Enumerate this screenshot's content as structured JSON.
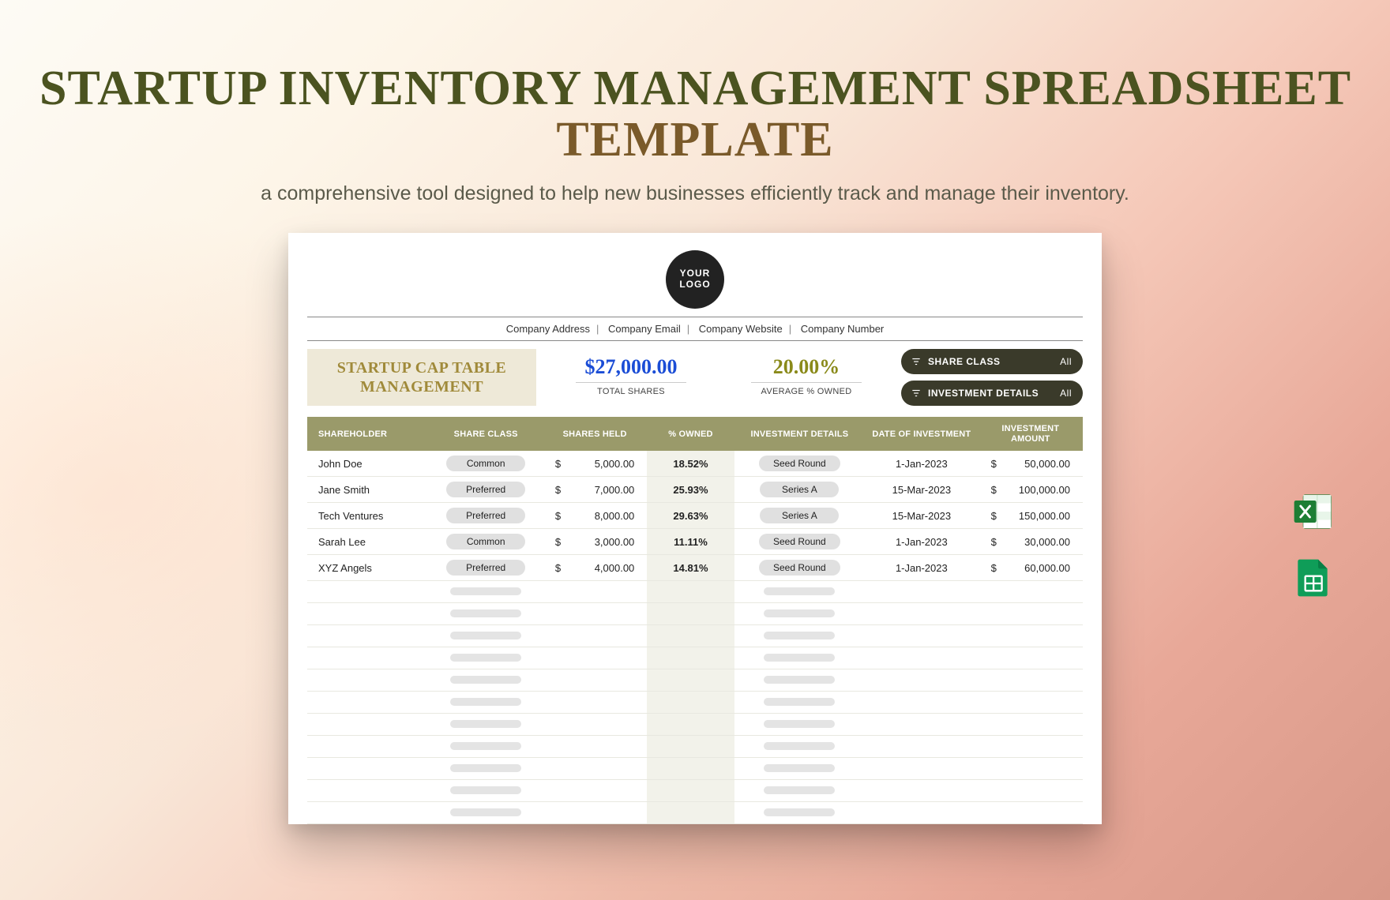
{
  "page": {
    "title_main": "STARTUP INVENTORY MANAGEMENT SPREADSHEET",
    "title_accent": "TEMPLATE",
    "subtitle": "a comprehensive tool designed to help new businesses efficiently track and manage their inventory."
  },
  "logo": {
    "line1": "YOUR",
    "line2": "LOGO"
  },
  "company_meta": {
    "address": "Company Address",
    "email": "Company Email",
    "website": "Company Website",
    "number": "Company Number"
  },
  "sheet": {
    "title": "STARTUP CAP TABLE MANAGEMENT",
    "total_shares": {
      "value": "$27,000.00",
      "label": "TOTAL SHARES"
    },
    "avg_owned": {
      "value": "20.00%",
      "label": "AVERAGE % OWNED"
    }
  },
  "filters": {
    "share_class": {
      "label": "SHARE CLASS",
      "value": "All"
    },
    "investment_details": {
      "label": "INVESTMENT DETAILS",
      "value": "All"
    }
  },
  "columns": {
    "shareholder": "SHAREHOLDER",
    "share_class": "SHARE CLASS",
    "shares_held": "SHARES HELD",
    "pct_owned": "% OWNED",
    "inv_details": "INVESTMENT DETAILS",
    "date": "DATE OF INVESTMENT",
    "amount": "INVESTMENT AMOUNT"
  },
  "rows": [
    {
      "shareholder": "John Doe",
      "share_class": "Common",
      "shares_held": "5,000.00",
      "pct_owned": "18.52%",
      "inv_details": "Seed Round",
      "date": "1-Jan-2023",
      "amount": "50,000.00"
    },
    {
      "shareholder": "Jane Smith",
      "share_class": "Preferred",
      "shares_held": "7,000.00",
      "pct_owned": "25.93%",
      "inv_details": "Series A",
      "date": "15-Mar-2023",
      "amount": "100,000.00"
    },
    {
      "shareholder": "Tech Ventures",
      "share_class": "Preferred",
      "shares_held": "8,000.00",
      "pct_owned": "29.63%",
      "inv_details": "Series A",
      "date": "15-Mar-2023",
      "amount": "150,000.00"
    },
    {
      "shareholder": "Sarah Lee",
      "share_class": "Common",
      "shares_held": "3,000.00",
      "pct_owned": "11.11%",
      "inv_details": "Seed Round",
      "date": "1-Jan-2023",
      "amount": "30,000.00"
    },
    {
      "shareholder": "XYZ Angels",
      "share_class": "Preferred",
      "shares_held": "4,000.00",
      "pct_owned": "14.81%",
      "inv_details": "Seed Round",
      "date": "1-Jan-2023",
      "amount": "60,000.00"
    }
  ],
  "empty_row_count": 11,
  "format_icons": {
    "excel": "Excel",
    "sheets": "Google Sheets"
  }
}
